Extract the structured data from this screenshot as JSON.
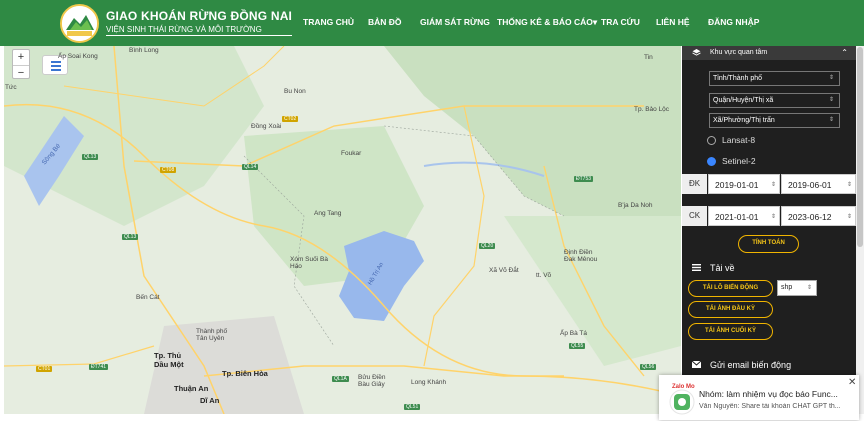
{
  "header": {
    "brand_title": "GIAO KHOÁN RỪNG ĐỒNG NAI",
    "brand_subtitle": "VIỆN SINH THÁI RỪNG VÀ MÔI TRƯỜNG",
    "nav": [
      "TRANG CHỦ",
      "BẢN ĐỒ",
      "GIÁM SÁT RỪNG",
      "THỐNG KÊ & BÁO CÁO",
      "TRA CỨU",
      "LIÊN HỆ",
      "ĐĂNG NHẬP"
    ],
    "colors": {
      "header_bg": "#2f8a44",
      "accent": "#f0b400",
      "panel_bg": "#1f1f1f"
    }
  },
  "map": {
    "zoom_in": "+",
    "zoom_out": "−",
    "labels": [
      "Tức",
      "Bình Long",
      "Ấp Soai Kong",
      "Bu Non",
      "Đồng Xoài",
      "Sông Bé",
      "Foukar",
      "Ang Tang",
      "Xóm Suối Bà Hào",
      "Hồ Trị An",
      "Xã Võ Đắt",
      "Định Điền Đak Mênou",
      "tt. Võ",
      "Bến Cát",
      "Thành phố Tân Uyên",
      "Tp. Thủ Dầu Một",
      "Thuận An",
      "Dĩ An",
      "Tp. Biên Hòa",
      "Bửu Điền Bàu Giây",
      "Long Khánh",
      "Ấp Bà Tá",
      "Tp. Bảo Lộc",
      "B'ja Da Noh",
      "Tin"
    ],
    "roads": [
      "QL13",
      "QL14",
      "CT02",
      "CT08",
      "QL20",
      "QL1A",
      "QL13",
      "QL51",
      "QL55",
      "QL56",
      "ĐT741",
      "ĐT753",
      "CT01"
    ]
  },
  "panel": {
    "section_title": "Khu vực quan tâm",
    "province_select": "Tỉnh/Thành phố",
    "district_select": "Quận/Huyện/Thị xã",
    "commune_select": "Xã/Phường/Thị trấn",
    "satellite_options": [
      "Lansat-8",
      "Setinel-2"
    ],
    "selected_satellite": "Setinel-2",
    "dk_label": "ĐK",
    "dk_from": "2019-01-01",
    "dk_to": "2019-06-01",
    "ck_label": "CK",
    "ck_from": "2021-01-01",
    "ck_to": "2023-06-12",
    "compute_button": "TÍNH TOÁN",
    "download_title": "Tải về",
    "download_change": "TẢI LÔ BIẾN ĐỘNG",
    "format_value": "shp",
    "download_start": "TẢI ẢNH ĐẦU KỲ",
    "download_end": "TẢI ẢNH CUỐI KỲ",
    "email_title": "Gửi email biến động"
  },
  "toast": {
    "title": "Nhóm: làm nhiệm vụ đọc báo Func...",
    "message": "Văn Nguyễn: Share tài khoản CHAT GPT th...",
    "app_badge": "Zalo Mo"
  }
}
